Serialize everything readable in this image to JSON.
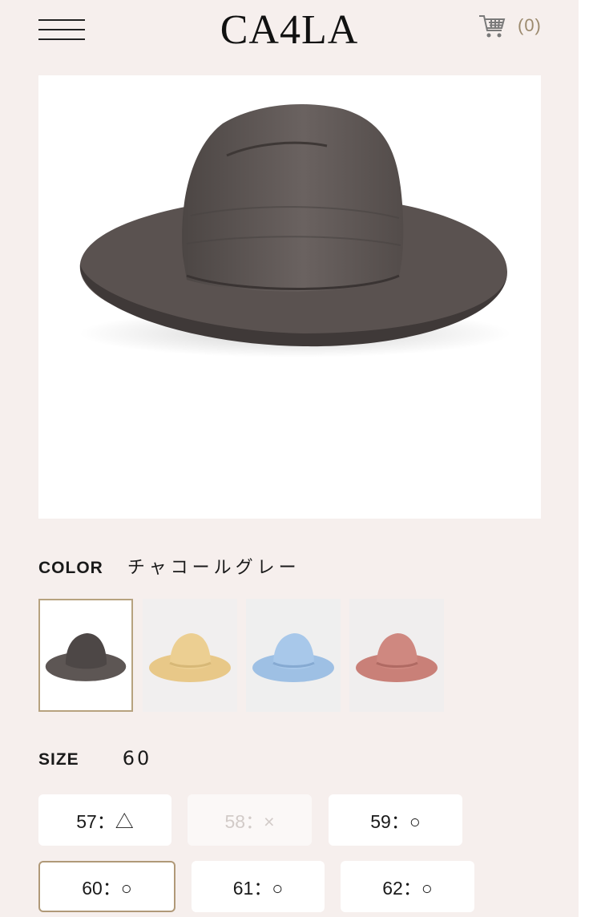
{
  "header": {
    "logo": "CA4LA",
    "cart_count": "(0)"
  },
  "product": {
    "image_icon": "charcoal-hat-image"
  },
  "color": {
    "label": "COLOR",
    "selected": "チャコールグレー",
    "swatches": [
      {
        "name": "charcoal",
        "hat_color": "#5d5654",
        "bg": "#ffffff"
      },
      {
        "name": "beige",
        "hat_color": "#e7c98a",
        "bg": "#f1efef"
      },
      {
        "name": "light-blue",
        "hat_color": "#9ec0e4",
        "bg": "#efefef"
      },
      {
        "name": "rose",
        "hat_color": "#c98078",
        "bg": "#f0eeee"
      }
    ]
  },
  "size": {
    "label": "SIZE",
    "selected": "60",
    "options": [
      {
        "text": "57：△"
      },
      {
        "text": "58：×"
      },
      {
        "text": "59：○"
      },
      {
        "text": "60：○"
      },
      {
        "text": "61：○"
      },
      {
        "text": "62：○"
      }
    ]
  },
  "colors": {
    "accent": "#b09978",
    "background": "#f6efed"
  }
}
